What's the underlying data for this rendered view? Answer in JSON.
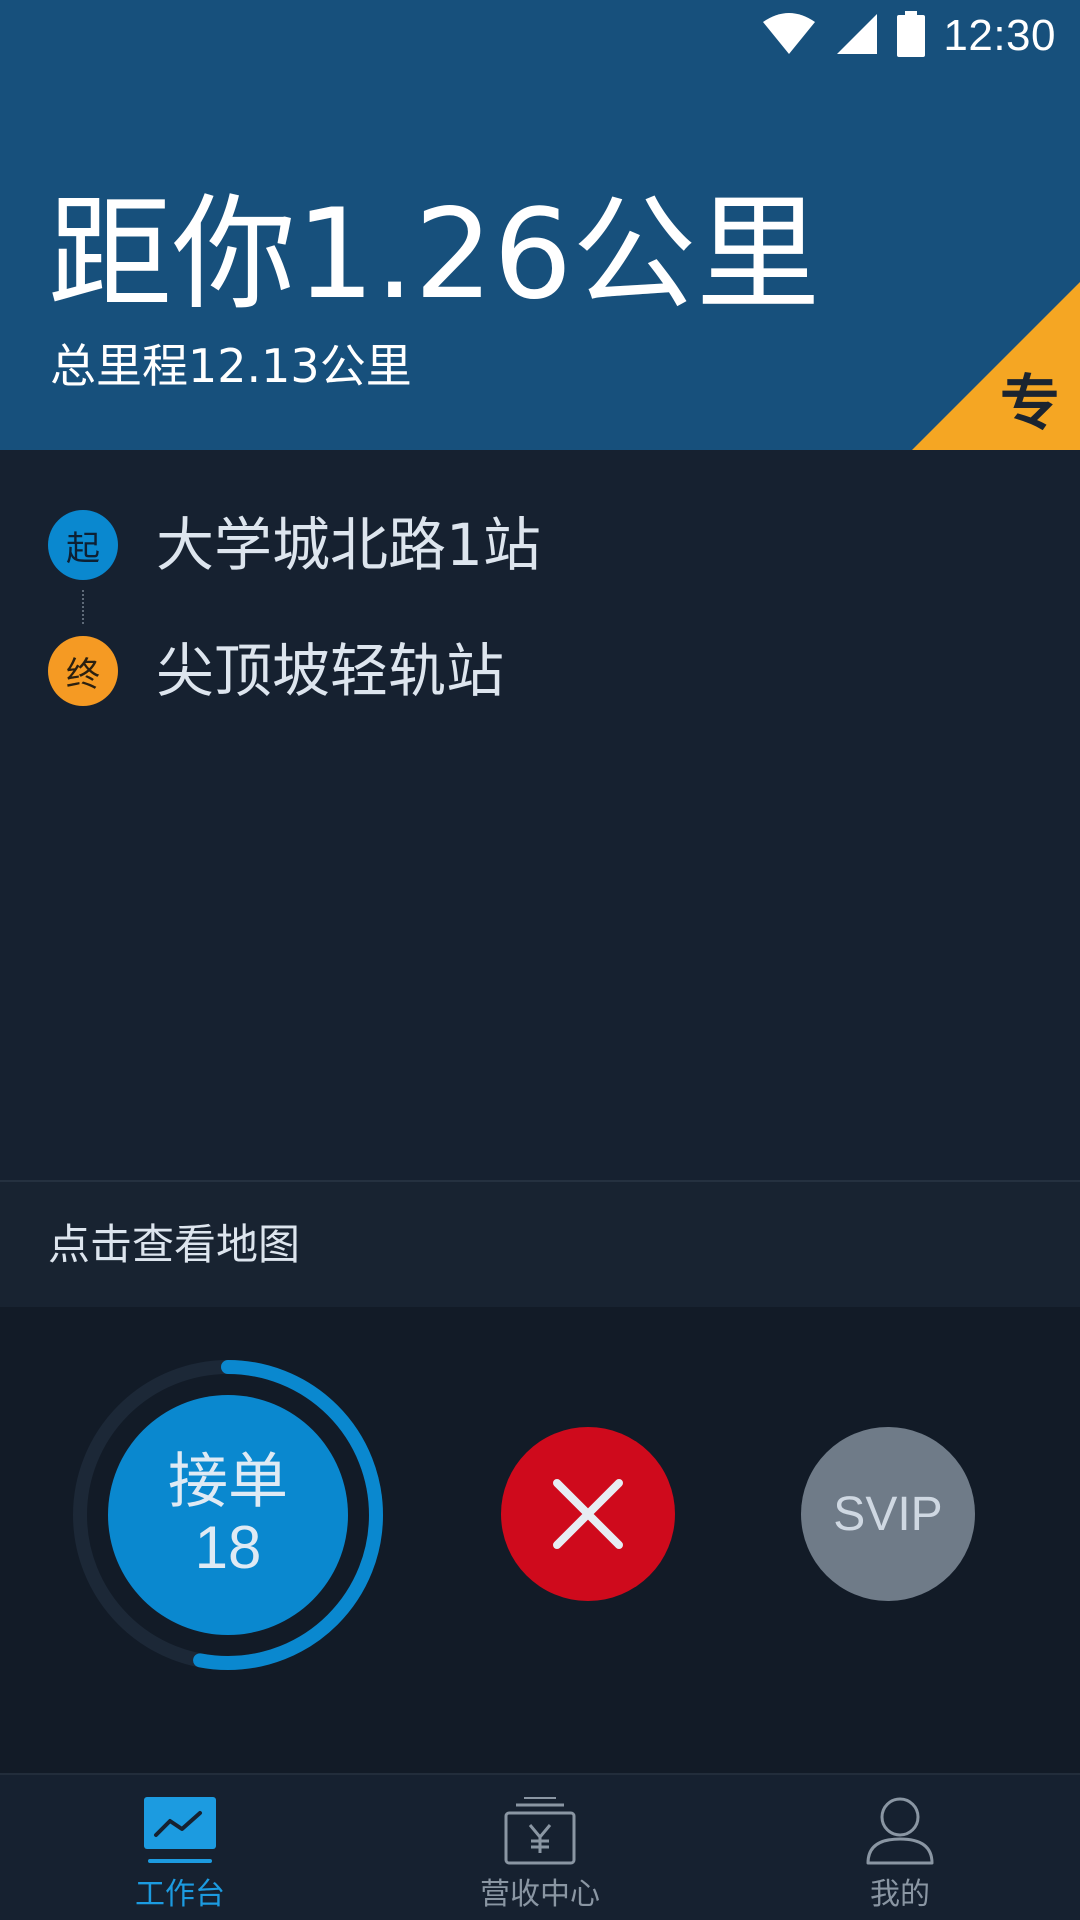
{
  "status_bar": {
    "time": "12:30",
    "icons": [
      "wifi-icon",
      "cell-signal-icon",
      "battery-icon"
    ]
  },
  "header": {
    "distance": "距你1.26公里",
    "total_mileage": "总里程12.13公里",
    "badge": "专"
  },
  "route": {
    "start_marker": "起",
    "start": "大学城北路1站",
    "end_marker": "终",
    "end": "尖顶坡轻轨站"
  },
  "map_link": {
    "label": "点击查看地图"
  },
  "actions": {
    "accept_label": "接单",
    "accept_count": "18",
    "countdown_progress": 0.53,
    "svip_label": "SVIP"
  },
  "tabs": [
    {
      "label": "工作台",
      "icon": "dashboard-chart-icon",
      "active": true
    },
    {
      "label": "营收中心",
      "icon": "revenue-yuan-icon",
      "active": false
    },
    {
      "label": "我的",
      "icon": "user-profile-icon",
      "active": false
    }
  ],
  "colors": {
    "header_bg": "#17507c",
    "accent_blue": "#0a88cf",
    "end_orange": "#f59a23",
    "reject_red": "#cf0a1c",
    "svip_gray": "#6f7b88",
    "active_tab": "#1c9be0",
    "inactive_tab": "#8a96a3"
  }
}
